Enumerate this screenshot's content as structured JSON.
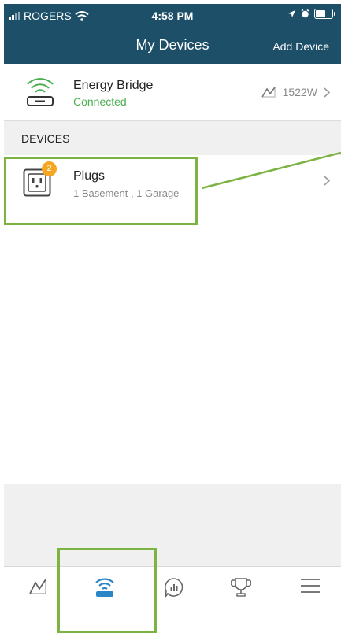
{
  "status_bar": {
    "carrier": "ROGERS",
    "time": "4:58 PM"
  },
  "nav": {
    "title": "My Devices",
    "action": "Add Device"
  },
  "bridge": {
    "name": "Energy Bridge",
    "status": "Connected",
    "power": "1522W"
  },
  "section": {
    "title": "DEVICES"
  },
  "device": {
    "name": "Plugs",
    "badge": "2",
    "locations": "1 Basement , 1 Garage"
  },
  "colors": {
    "header": "#1d4f68",
    "connected": "#4caf50",
    "badge": "#f5a623",
    "active_tab": "#2a86c4",
    "annotation": "#7cb342"
  },
  "icons": [
    "wifi-icon",
    "signal-icon",
    "location-icon",
    "alarm-icon",
    "battery-icon",
    "energy-bridge-icon",
    "usage-graph-icon",
    "plug-icon",
    "chevron-right-icon",
    "devices-icon",
    "chat-insights-icon",
    "trophy-icon",
    "menu-icon"
  ]
}
